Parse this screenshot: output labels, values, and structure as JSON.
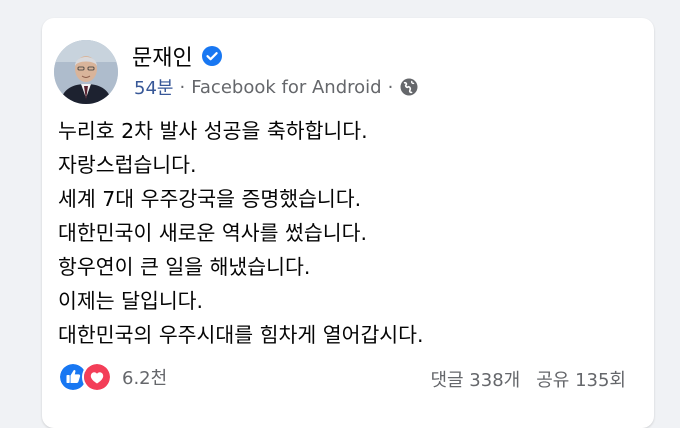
{
  "post": {
    "author": "문재인",
    "time": "54분",
    "source": "Facebook for Android",
    "separator": "·",
    "lines": [
      "누리호 2차 발사 성공을 축하합니다.",
      "자랑스럽습니다.",
      "세계 7대 우주강국을 증명했습니다.",
      "대한민국이 새로운 역사를 썼습니다.",
      "항우연이 큰 일을 해냈습니다.",
      "이제는 달입니다.",
      "대한민국의 우주시대를 힘차게 열어갑시다."
    ],
    "reactions_count": "6.2천",
    "comments": "댓글 338개",
    "shares": "공유 135회"
  },
  "icons": {
    "verified": "verified-badge-icon",
    "globe": "globe-icon",
    "like": "like-icon",
    "love": "love-icon"
  },
  "colors": {
    "accent": "#1877f2",
    "love": "#f33e58",
    "secondary_text": "#65676b",
    "background": "#f0f2f5"
  }
}
